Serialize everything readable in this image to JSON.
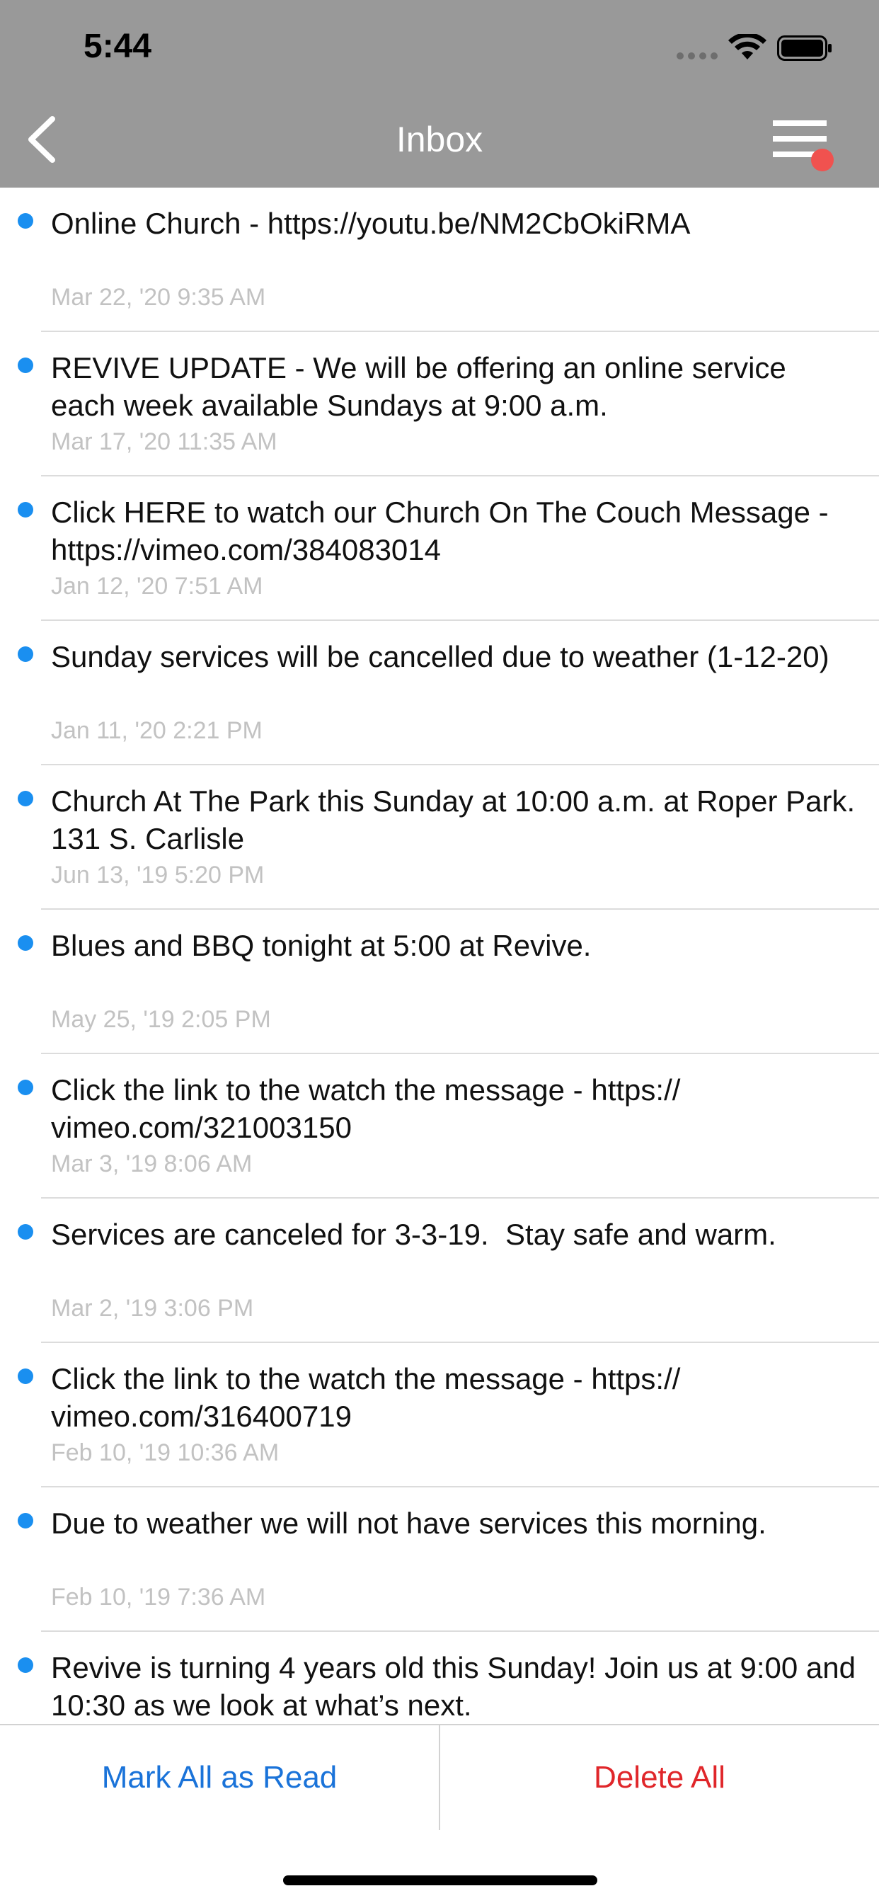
{
  "status_bar": {
    "time": "5:44"
  },
  "nav": {
    "title": "Inbox"
  },
  "colors": {
    "unread_dot": "#1a8ff0",
    "mark_all": "#1a73d9",
    "delete_all": "#e0262a",
    "badge": "#f0524f",
    "header_bg": "#999999"
  },
  "messages": [
    {
      "text": "Online Church - https://youtu.be/NM2CbOkiRMA",
      "date": "Mar 22, '20 9:35 AM",
      "unread": true
    },
    {
      "text": "REVIVE UPDATE - We will be offering an online service each week available Sundays at 9:00 a.m.",
      "date": "Mar 17, '20 11:35 AM",
      "unread": true
    },
    {
      "text": "Click HERE to watch our Church On The Couch Message - https://vimeo.com/384083014",
      "date": "Jan 12, '20 7:51 AM",
      "unread": true
    },
    {
      "text": "Sunday services will be cancelled due to weather (1-12-20)",
      "date": "Jan 11, '20 2:21 PM",
      "unread": true
    },
    {
      "text": "Church At The Park this Sunday at 10:00 a.m. at Roper Park. 131 S. Carlisle",
      "date": "Jun 13, '19 5:20 PM",
      "unread": true
    },
    {
      "text": "Blues and BBQ tonight at 5:00 at Revive.",
      "date": "May 25, '19 2:05 PM",
      "unread": true
    },
    {
      "text": "Click the link to the watch the message - https://\nvimeo.com/321003150",
      "date": "Mar 3, '19 8:06 AM",
      "unread": true
    },
    {
      "text": "Services are canceled for 3-3-19.  Stay safe and warm.",
      "date": "Mar 2, '19 3:06 PM",
      "unread": true
    },
    {
      "text": "Click the link to the watch the message - https://\nvimeo.com/316400719",
      "date": "Feb 10, '19 10:36 AM",
      "unread": true
    },
    {
      "text": "Due to weather we will not have services this morning.",
      "date": "Feb 10, '19 7:36 AM",
      "unread": true
    },
    {
      "text": "Revive is turning 4 years old this Sunday! Join us at 9:00 and 10:30 as we look at what’s next.",
      "date": "",
      "unread": true
    }
  ],
  "footer": {
    "mark_all_label": "Mark All as Read",
    "delete_all_label": "Delete All"
  }
}
